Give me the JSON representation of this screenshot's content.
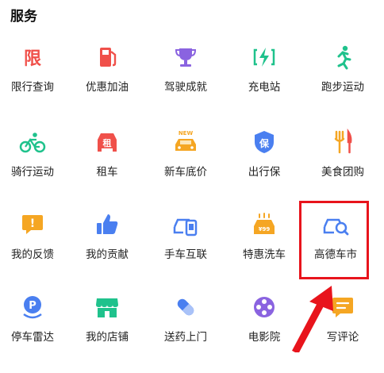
{
  "section": {
    "title": "服务"
  },
  "rows": [
    [
      {
        "icon": "restriction-icon",
        "label": "限行查询",
        "icon_text": "限"
      },
      {
        "icon": "fuel-pump-icon",
        "label": "优惠加油"
      },
      {
        "icon": "trophy-icon",
        "label": "驾驶成就"
      },
      {
        "icon": "charging-icon",
        "label": "充电站"
      },
      {
        "icon": "running-icon",
        "label": "跑步运动"
      }
    ],
    [
      {
        "icon": "bicycle-icon",
        "label": "骑行运动"
      },
      {
        "icon": "rental-car-icon",
        "label": "租车",
        "icon_text": "租"
      },
      {
        "icon": "new-car-icon",
        "label": "新车底价",
        "icon_text": "NEW"
      },
      {
        "icon": "shield-icon",
        "label": "出行保",
        "icon_text": "保"
      },
      {
        "icon": "food-icon",
        "label": "美食团购"
      }
    ],
    [
      {
        "icon": "feedback-icon",
        "label": "我的反馈",
        "icon_text": "!"
      },
      {
        "icon": "thumbs-up-icon",
        "label": "我的贡献"
      },
      {
        "icon": "phone-car-icon",
        "label": "手车互联"
      },
      {
        "icon": "car-wash-icon",
        "label": "特惠洗车",
        "icon_text": "¥99"
      },
      {
        "icon": "car-search-icon",
        "label": "高德车市"
      }
    ],
    [
      {
        "icon": "parking-radar-icon",
        "label": "停车雷达",
        "icon_text": "P"
      },
      {
        "icon": "store-icon",
        "label": "我的店铺"
      },
      {
        "icon": "pill-icon",
        "label": "送药上门"
      },
      {
        "icon": "film-reel-icon",
        "label": "电影院"
      },
      {
        "icon": "comment-icon",
        "label": "写评论"
      }
    ]
  ],
  "colors": {
    "highlight": "#e8141c",
    "red": "#f0504a",
    "purple": "#8a63e0",
    "green": "#1fc28c",
    "orange": "#f5a623",
    "blue": "#4a7ff0"
  }
}
